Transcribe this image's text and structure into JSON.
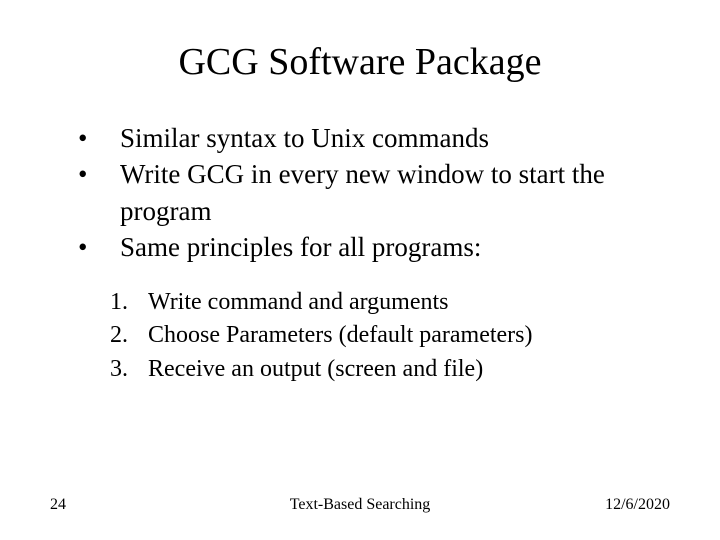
{
  "title": "GCG Software Package",
  "bullets": [
    "Similar syntax to Unix commands",
    "Write GCG in every new window to start the program",
    "Same principles for all programs:"
  ],
  "numbered": [
    "Write command and arguments",
    "Choose Parameters (default parameters)",
    "Receive an output (screen and file)"
  ],
  "footer": {
    "page": "24",
    "center": "Text-Based Searching",
    "date": "12/6/2020"
  }
}
